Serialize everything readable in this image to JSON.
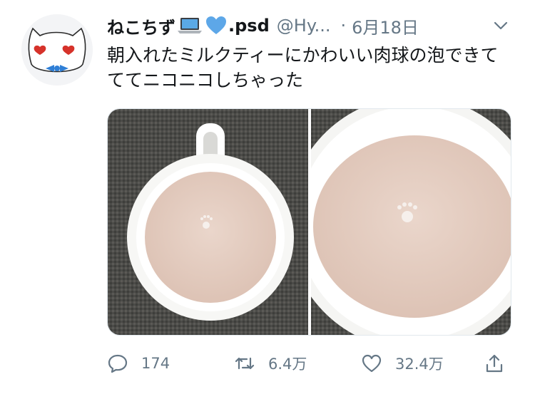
{
  "tweet": {
    "display_name": "ねこちず",
    "name_suffix": ".psd",
    "handle": "@Hy...",
    "separator": "·",
    "date": "6月18日",
    "text": "朝入れたミルクティーにかわいい肉球の泡できてててニコニコしちゃった"
  },
  "icons": {
    "name_emoji_1": "laptop-icon",
    "name_emoji_2": "blue-heart-icon",
    "menu": "chevron-down-icon"
  },
  "media": {
    "image_1": "milk tea mug top view with paw-print foam",
    "image_2": "milk tea close-up with paw-print foam"
  },
  "actions": {
    "reply_count": "174",
    "retweet_count": "6.4万",
    "like_count": "32.4万"
  },
  "colors": {
    "text": "#14171a",
    "secondary": "#657786",
    "tea": "#e6cfc3"
  }
}
